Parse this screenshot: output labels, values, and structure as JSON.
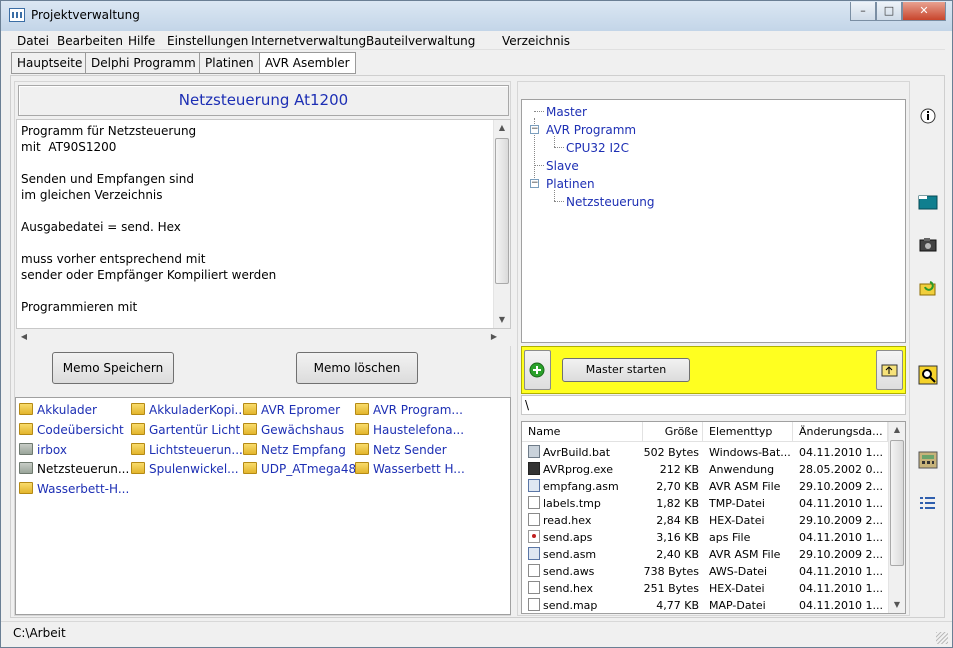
{
  "window": {
    "title": "Projektverwaltung",
    "minimize": "–",
    "maximize": "□",
    "close": "✕"
  },
  "menu": [
    "Datei",
    "Bearbeiten",
    "Hilfe",
    "Einstellungen",
    "Internetverwaltung",
    "Bauteilverwaltung",
    "Verzeichnis"
  ],
  "tabs": [
    "Hauptseite",
    "Delphi Programm",
    "Platinen",
    "AVR Asembler"
  ],
  "active_tab": "AVR Asembler",
  "project": {
    "heading": "Netzsteuerung At1200",
    "memo_text": "Programm für Netzsteuerung\nmit  AT90S1200\n\nSenden und Empfangen sind\nim gleichen Verzeichnis\n\nAusgabedatei = send. Hex\n\nmuss vorher entsprechend mit\nsender oder Empfänger Kompiliert werden\n\nProgrammieren mit"
  },
  "buttons": {
    "memo_save": "Memo Speichern",
    "memo_delete": "Memo löschen",
    "master_start": "Master starten"
  },
  "folders": [
    [
      "Akkulader",
      "AkkuladerKopi...",
      "AVR Epromer",
      "AVR Program..."
    ],
    [
      "Codeübersicht",
      "Gartentür Licht",
      "Gewächshaus",
      "Haustelefona..."
    ],
    [
      "irbox",
      "Lichtsteuerun...",
      "Netz Empfang",
      "Netz Sender"
    ],
    [
      "Netzsteuerun...",
      "Spulenwickel...",
      "UDP_ATmega48",
      "Wasserbett H..."
    ],
    [
      "Wasserbett-H..."
    ]
  ],
  "tree": {
    "master": "Master",
    "avr_program": "AVR Programm",
    "cpu": "CPU32  I2C",
    "slave": "Slave",
    "platinen": "Platinen",
    "netzsteuerung": "Netzsteuerung"
  },
  "path": "\\",
  "filelist": {
    "columns": [
      "Name",
      "Größe",
      "Elementtyp",
      "Änderungsda..."
    ],
    "rows": [
      {
        "name": "AvrBuild.bat",
        "size": "502 Bytes",
        "type": "Windows-Bat...",
        "date": "04.11.2010 1...",
        "icon": "bat"
      },
      {
        "name": "AVRprog.exe",
        "size": "212 KB",
        "type": "Anwendung",
        "date": "28.05.2002 0...",
        "icon": "exe"
      },
      {
        "name": "empfang.asm",
        "size": "2,70 KB",
        "type": "AVR ASM File",
        "date": "29.10.2009 2...",
        "icon": "asm"
      },
      {
        "name": "labels.tmp",
        "size": "1,82 KB",
        "type": "TMP-Datei",
        "date": "04.11.2010 1...",
        "icon": "doc"
      },
      {
        "name": "read.hex",
        "size": "2,84 KB",
        "type": "HEX-Datei",
        "date": "29.10.2009 2...",
        "icon": "doc"
      },
      {
        "name": "send.aps",
        "size": "3,16 KB",
        "type": "aps File",
        "date": "04.11.2010 1...",
        "icon": "aps"
      },
      {
        "name": "send.asm",
        "size": "2,40 KB",
        "type": "AVR ASM File",
        "date": "29.10.2009 2...",
        "icon": "asm"
      },
      {
        "name": "send.aws",
        "size": "738 Bytes",
        "type": "AWS-Datei",
        "date": "04.11.2010 1...",
        "icon": "doc"
      },
      {
        "name": "send.hex",
        "size": "251 Bytes",
        "type": "HEX-Datei",
        "date": "04.11.2010 1...",
        "icon": "doc"
      },
      {
        "name": "send.map",
        "size": "4,77 KB",
        "type": "MAP-Datei",
        "date": "04.11.2010 1...",
        "icon": "doc"
      }
    ]
  },
  "status": "C:\\Arbeit",
  "side_icons": [
    "info-icon",
    "folder-open-icon",
    "camera-icon",
    "folder-refresh-icon",
    "magnifier-icon",
    "calculator-icon",
    "list-icon"
  ],
  "colors": {
    "accent_text": "#1d2fb4",
    "yellow_panel": "#ffff20"
  }
}
